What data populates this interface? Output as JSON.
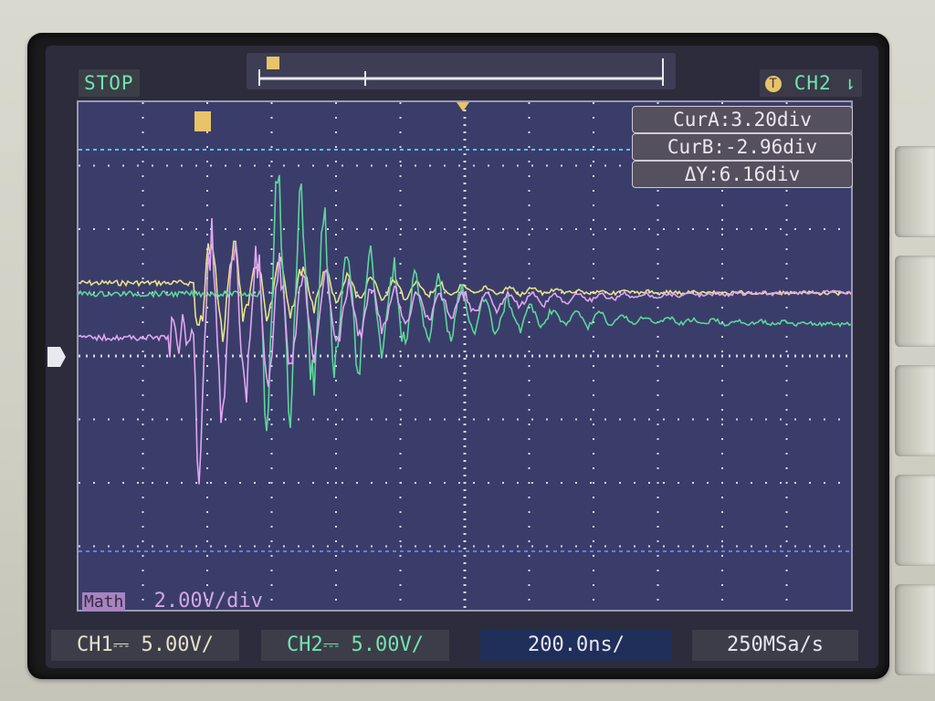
{
  "status": {
    "run_state": "STOP",
    "trigger_channel": "CH2",
    "trigger_icon": "trigger-T-icon",
    "trigger_edge": "⇂"
  },
  "cursors": {
    "a": "CurA:3.20div",
    "b": "CurB:-2.96div",
    "delta": "ΔY:6.16div"
  },
  "math": {
    "tag": "Math",
    "scale": "2.00V/div"
  },
  "bottom": {
    "ch1": "CH1⎓  5.00V/",
    "ch2": "CH2⎓  5.00V/",
    "timebase": "200.0ns/",
    "sample_rate": "250MSa/s"
  },
  "colors": {
    "ch1": "#e8e28a",
    "ch2": "#5cd69a",
    "math": "#e0a6f0",
    "cursor_a": "#5ec3e8",
    "cursor_b": "#6a7ae8",
    "grid_bg": "#3a3d6a"
  }
}
